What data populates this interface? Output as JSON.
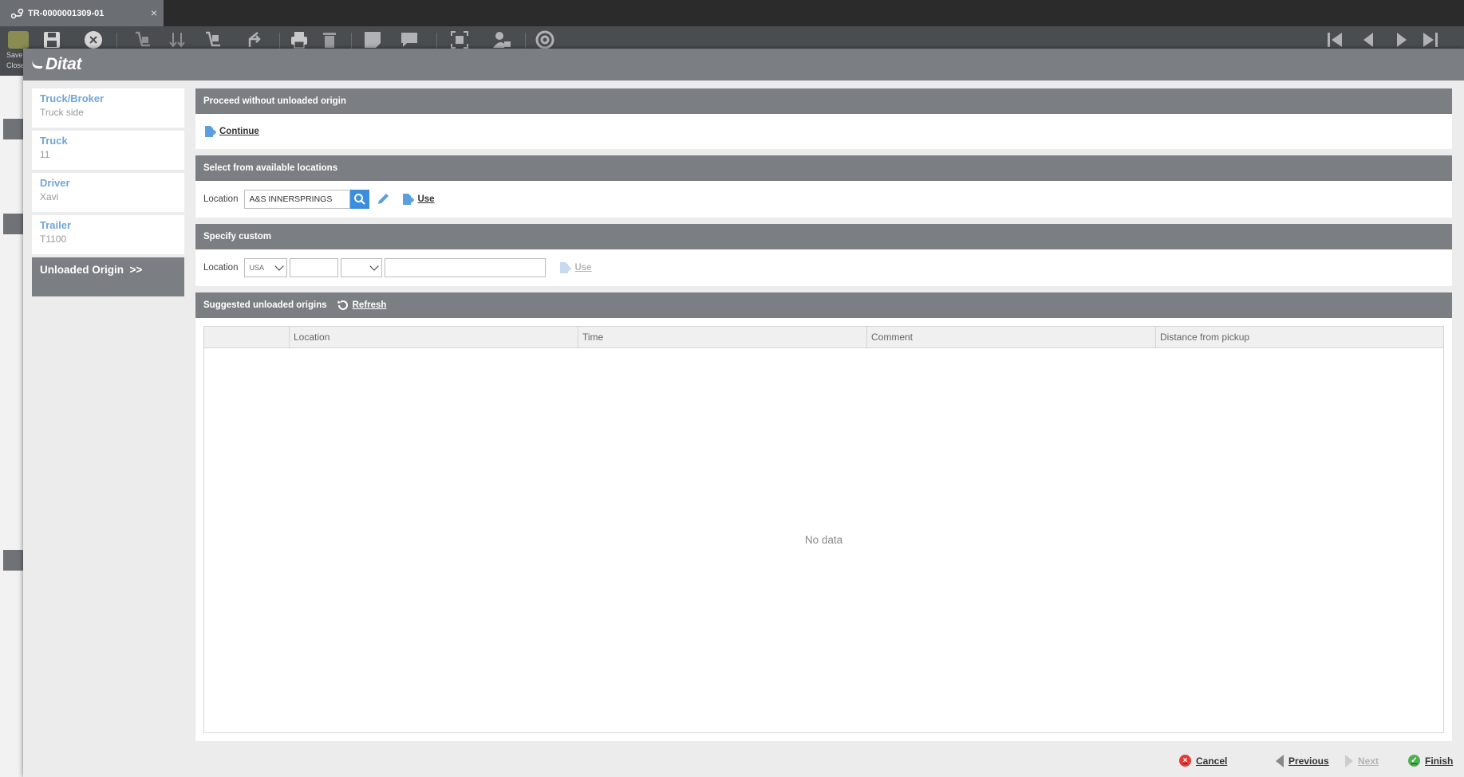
{
  "tab": {
    "title": "TR-0000001309-01",
    "close": "×"
  },
  "toolbar": {
    "save_close_label": "Save Close"
  },
  "app": {
    "logo": "Ditat"
  },
  "steps": [
    {
      "title": "Truck/Broker",
      "value": "Truck side"
    },
    {
      "title": "Truck",
      "value": "11"
    },
    {
      "title": "Driver",
      "value": "Xavi"
    },
    {
      "title": "Trailer",
      "value": "T1100"
    },
    {
      "title": "Unloaded Origin  >>",
      "value": ""
    }
  ],
  "proceed": {
    "header": "Proceed without unloaded origin",
    "continue_label": "Continue"
  },
  "available": {
    "header": "Select from available locations",
    "location_label": "Location",
    "location_value": "A&S INNERSPRINGS",
    "use_label": "Use"
  },
  "custom": {
    "header": "Specify custom",
    "location_label": "Location",
    "country_value": "USA",
    "use_label": "Use"
  },
  "suggested": {
    "header": "Suggested unloaded origins",
    "refresh_label": "Refresh",
    "columns": [
      "",
      "Location",
      "Time",
      "Comment",
      "Distance from pickup"
    ],
    "empty_text": "No data"
  },
  "footer": {
    "cancel": "Cancel",
    "previous": "Previous",
    "next": "Next",
    "finish": "Finish"
  },
  "colors": {
    "accent_blue": "#3b8ede",
    "header_gray": "#7b7f83",
    "step_link": "#6fa6dc",
    "cancel_red": "#e53935",
    "finish_green": "#4caf50"
  }
}
